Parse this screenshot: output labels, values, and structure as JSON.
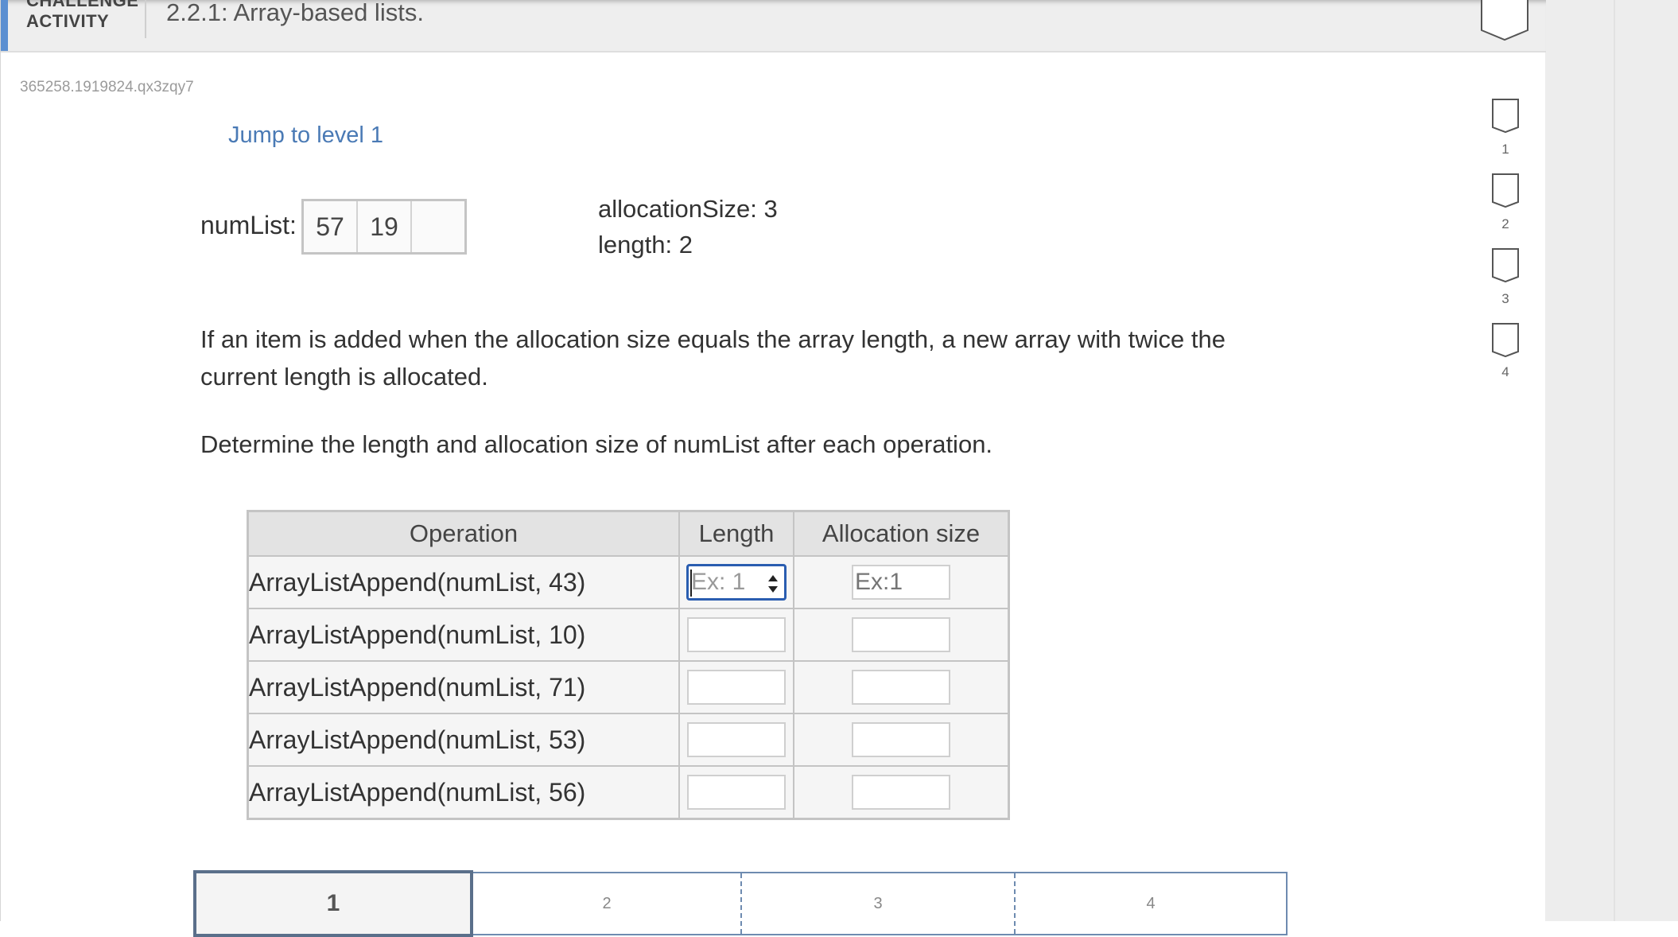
{
  "header": {
    "label_top": "CHALLENGE",
    "label_bottom": "ACTIVITY",
    "title": "2.2.1: Array-based lists."
  },
  "activity_id": "365258.1919824.qx3zqy7",
  "jump_link": "Jump to level 1",
  "numlist": {
    "label": "numList:",
    "cells": [
      "57",
      "19",
      ""
    ]
  },
  "allocation_text": "allocationSize: 3",
  "length_text": "length: 2",
  "instructions": {
    "paragraph1": "If an item is added when the allocation size equals the array length, a new array with twice the current length is allocated.",
    "paragraph2": "Determine the length and allocation size of numList after each operation."
  },
  "table": {
    "headers": [
      "Operation",
      "Length",
      "Allocation size"
    ],
    "rows": [
      {
        "operation": "ArrayListAppend(numList, 43)",
        "length_placeholder": "Ex: 1",
        "alloc_placeholder": "Ex:1"
      },
      {
        "operation": "ArrayListAppend(numList, 10)",
        "length_placeholder": "",
        "alloc_placeholder": ""
      },
      {
        "operation": "ArrayListAppend(numList, 71)",
        "length_placeholder": "",
        "alloc_placeholder": ""
      },
      {
        "operation": "ArrayListAppend(numList, 53)",
        "length_placeholder": "",
        "alloc_placeholder": ""
      },
      {
        "operation": "ArrayListAppend(numList, 56)",
        "length_placeholder": "",
        "alloc_placeholder": ""
      }
    ]
  },
  "levels": [
    "1",
    "2",
    "3",
    "4"
  ],
  "side_levels": [
    "1",
    "2",
    "3",
    "4"
  ],
  "colors": {
    "accent": "#5b8fd1",
    "link": "#4a7ab5",
    "focus_border": "#2a5db0"
  }
}
